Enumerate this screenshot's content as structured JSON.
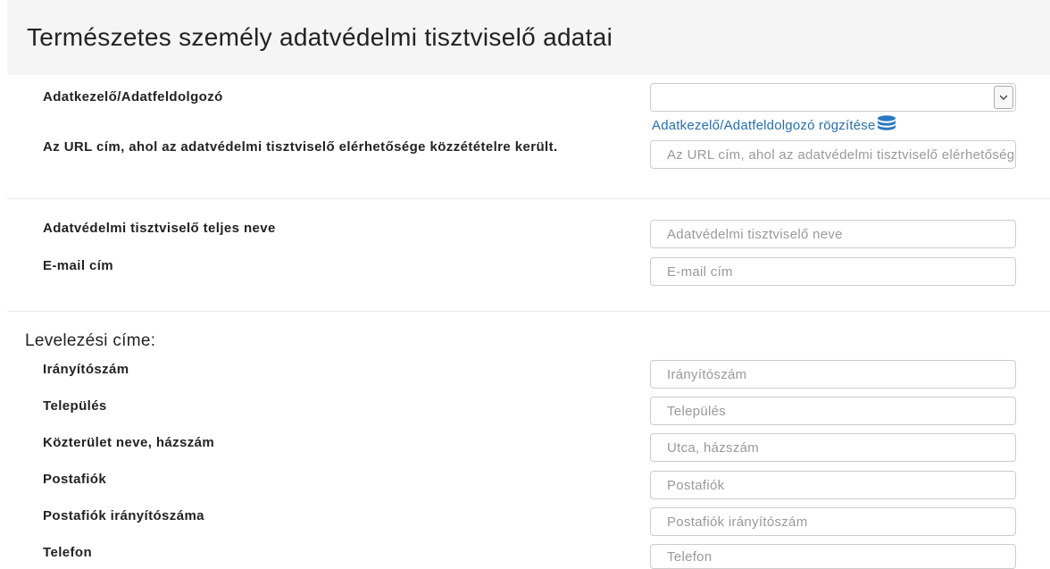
{
  "page": {
    "title": "Természetes személy adatvédelmi tisztviselő adatai"
  },
  "controller": {
    "label": "Adatkezelő/Adatfeldolgozó",
    "selected_value": "",
    "add_link": "Adatkezelő/Adatfeldolgozó rögzítése",
    "link_icon": "database-icon",
    "link_color": "#2a6fa8"
  },
  "url_field": {
    "label": "Az URL cím, ahol az adatvédelmi tisztviselő elérhetősége közzétételre került.",
    "placeholder": "Az URL cím, ahol az adatvédelmi tisztviselő elérhetősége"
  },
  "officer": {
    "name_label": "Adatvédelmi tisztviselő teljes neve",
    "name_placeholder": "Adatvédelmi tisztviselő neve",
    "email_label": "E-mail cím",
    "email_placeholder": "E-mail cím"
  },
  "address": {
    "section_title": "Levelezési címe:",
    "zip_label": "Irányítószám",
    "zip_placeholder": "Irányítószám",
    "city_label": "Település",
    "city_placeholder": "Település",
    "street_label": "Közterület neve, házszám",
    "street_placeholder": "Utca, házszám",
    "pobox_label": "Postafiók",
    "pobox_placeholder": "Postafiók",
    "pobox_zip_label": "Postafiók irányítószáma",
    "pobox_zip_placeholder": "Postafiók irányítószám",
    "phone_label": "Telefon",
    "phone_placeholder": "Telefon"
  }
}
